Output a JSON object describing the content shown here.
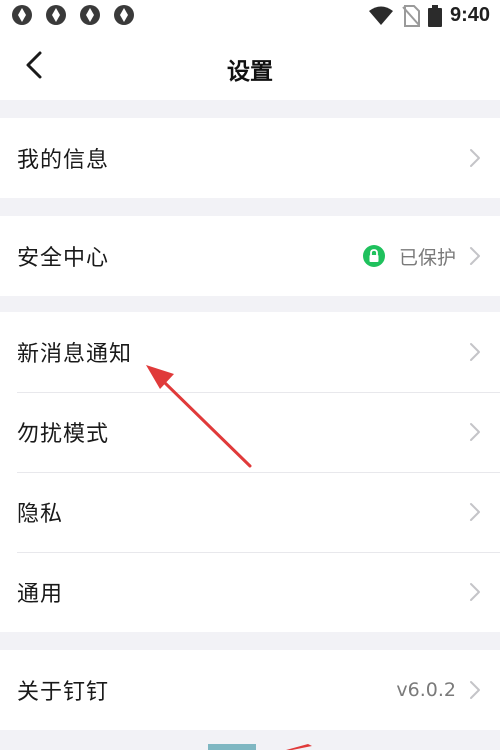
{
  "status_bar": {
    "time": "9:40",
    "notification_icons": [
      "app-notification-icon",
      "app-notification-icon",
      "app-notification-icon",
      "app-notification-icon"
    ],
    "system_icons": [
      "wifi-icon",
      "no-sim-icon",
      "battery-icon"
    ]
  },
  "header": {
    "title": "设置",
    "back_icon": "chevron-left-icon"
  },
  "groups": [
    {
      "items": [
        {
          "label": "我的信息"
        }
      ]
    },
    {
      "items": [
        {
          "label": "安全中心",
          "status": "已保护",
          "status_icon": "lock-icon"
        }
      ]
    },
    {
      "items": [
        {
          "label": "新消息通知"
        },
        {
          "label": "勿扰模式"
        },
        {
          "label": "隐私"
        },
        {
          "label": "通用"
        }
      ]
    },
    {
      "items": [
        {
          "label": "关于钉钉",
          "value": "v6.0.2"
        }
      ]
    }
  ],
  "colors": {
    "background": "#f2f2f6",
    "surface": "#ffffff",
    "protected_green": "#1fc15d",
    "annotation_red": "#e03a3a",
    "chevron_gray": "#c4c4c8"
  }
}
